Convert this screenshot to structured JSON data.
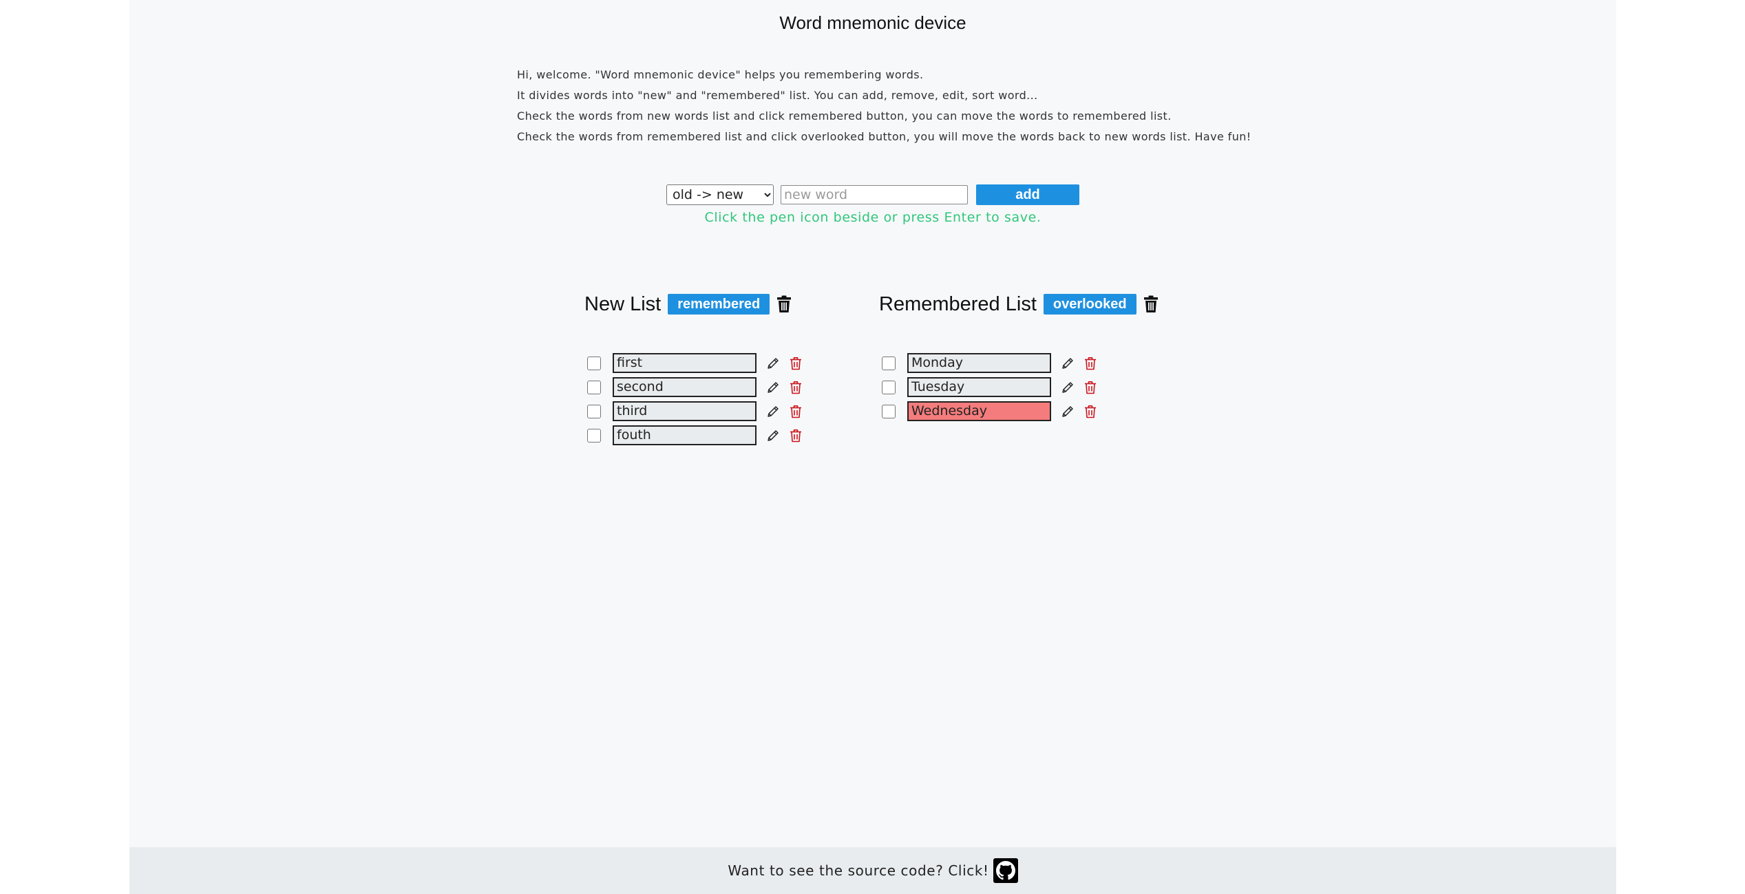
{
  "header": {
    "title": "Word mnemonic device"
  },
  "intro": {
    "lines": [
      "Hi, welcome. \"Word mnemonic device\" helps you remembering words.",
      "It divides words into \"new\" and \"remembered\" list. You can add, remove, edit, sort word...",
      "Check the words from new words list and click remembered button, you can move the words to remembered list.",
      "Check the words from remembered list and click overlooked button, you will move the words back to new words list. Have fun!"
    ]
  },
  "controls": {
    "sort_selected": "old -> new",
    "new_word_placeholder": "new word",
    "add_label": "add",
    "hint": "Click the pen icon beside or press Enter to save."
  },
  "new_list": {
    "title": "New List",
    "action_label": "remembered",
    "words": [
      "first",
      "second",
      "third",
      "fouth"
    ]
  },
  "remembered_list": {
    "title": "Remembered List",
    "action_label": "overlooked",
    "words": [
      "Monday",
      "Tuesday",
      "Wednesday"
    ],
    "highlighted_word": "Wednesday"
  },
  "footer": {
    "text": "Want to see the source code? Click!"
  },
  "icons": {
    "edit": "pen-icon",
    "delete": "trash-icon",
    "github": "github-icon"
  },
  "colors": {
    "accent": "#1e90e0",
    "hint": "#2fc77a",
    "delete_icon": "#c9141c",
    "highlight": "#f47c7c",
    "page_background": "#f7f8fa",
    "footer_background": "#e9ecef"
  }
}
